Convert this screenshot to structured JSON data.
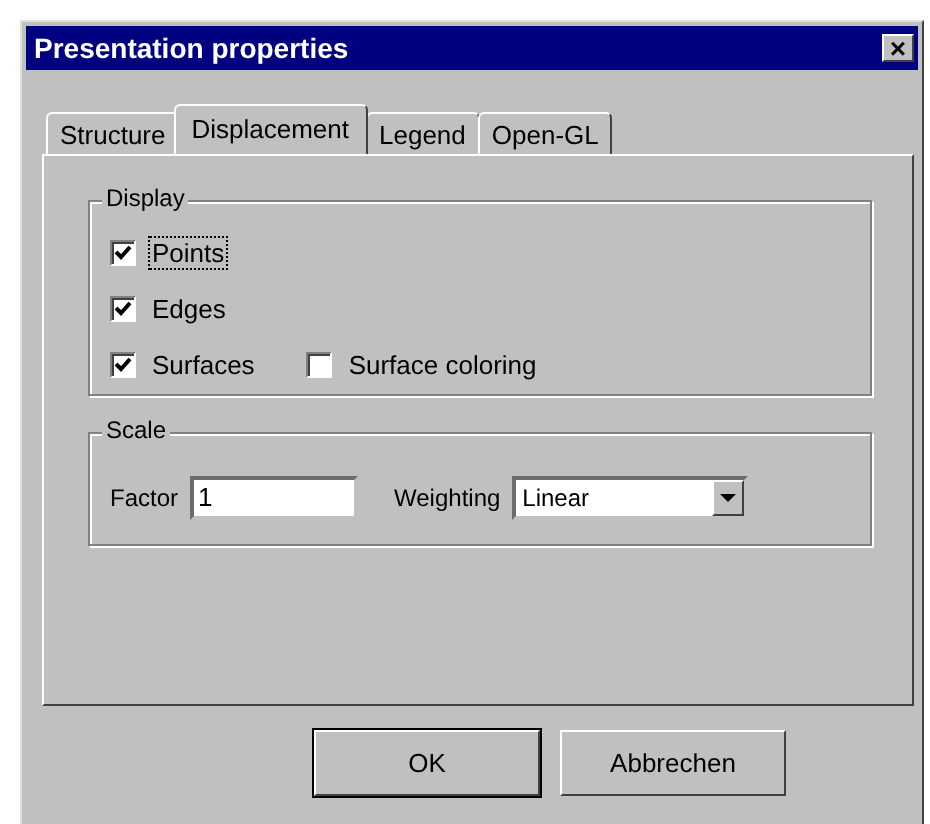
{
  "window": {
    "title": "Presentation properties",
    "close": "×"
  },
  "tabs": [
    {
      "label": "Structure",
      "selected": false
    },
    {
      "label": "Displacement",
      "selected": true
    },
    {
      "label": "Legend",
      "selected": false
    },
    {
      "label": "Open-GL",
      "selected": false
    }
  ],
  "display": {
    "title": "Display",
    "rows": [
      [
        {
          "label": "Points",
          "checked": true,
          "focused": true
        }
      ],
      [
        {
          "label": "Edges",
          "checked": true,
          "focused": false
        }
      ],
      [
        {
          "label": "Surfaces",
          "checked": true,
          "focused": false
        },
        {
          "label": "Surface coloring",
          "checked": false,
          "focused": false
        }
      ]
    ]
  },
  "scale": {
    "title": "Scale",
    "factor_label": "Factor",
    "factor_value": "1",
    "weighting_label": "Weighting",
    "weighting_value": "Linear"
  },
  "buttons": [
    {
      "label": "OK",
      "default": true
    },
    {
      "label": "Abbrechen",
      "default": false
    }
  ]
}
